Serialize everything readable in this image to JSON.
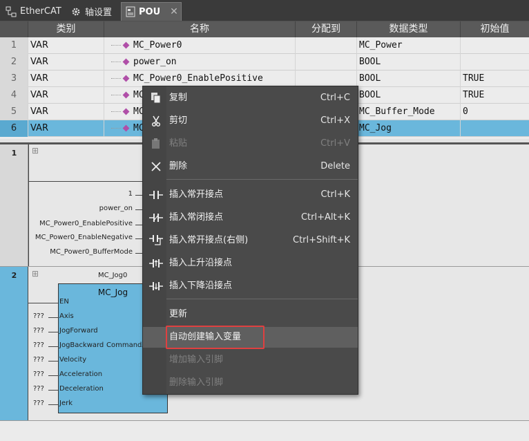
{
  "tabs": [
    {
      "label": "EtherCAT",
      "icon": "network-tree-icon"
    },
    {
      "label": "轴设置",
      "icon": "gear-icon"
    },
    {
      "label": "POU",
      "icon": "document-icon",
      "close": "✕"
    }
  ],
  "table": {
    "headers": [
      "类别",
      "名称",
      "分配到",
      "数据类型",
      "初始值"
    ],
    "rows": [
      {
        "n": "1",
        "cat": "VAR",
        "name": "MC_Power0",
        "assign": "",
        "type": "MC_Power",
        "init": ""
      },
      {
        "n": "2",
        "cat": "VAR",
        "name": "power_on",
        "assign": "",
        "type": "BOOL",
        "init": ""
      },
      {
        "n": "3",
        "cat": "VAR",
        "name": "MC_Power0_EnablePositive",
        "assign": "",
        "type": "BOOL",
        "init": "TRUE"
      },
      {
        "n": "4",
        "cat": "VAR",
        "name": "MC",
        "assign": "",
        "type": "BOOL",
        "init": "TRUE"
      },
      {
        "n": "5",
        "cat": "VAR",
        "name": "MC",
        "assign": "",
        "type": "MC_Buffer_Mode",
        "init": "0"
      },
      {
        "n": "6",
        "cat": "VAR",
        "name": "MC",
        "assign": "",
        "type": "MC_Jog",
        "init": ""
      }
    ]
  },
  "ladder": {
    "rung1": {
      "num": "1",
      "expand": "⊞",
      "inputs": [
        "1",
        "power_on",
        "MC_Power0_EnablePositive",
        "MC_Power0_EnableNegative",
        "MC_Power0_BufferMode"
      ]
    },
    "rung2": {
      "num": "2",
      "expand": "⊞",
      "instance": "MC_Jog0",
      "block_name": "MC_Jog",
      "pins": [
        "EN",
        "Axis",
        "JogForward",
        "JogBackward",
        "Velocity",
        "Acceleration",
        "Deceleration",
        "Jerk"
      ],
      "pin_extra": "CommandA",
      "unknown": "???"
    }
  },
  "context_menu": {
    "items": [
      {
        "label": "复制",
        "shortcut": "Ctrl+C",
        "icon": "copy-icon",
        "enabled": true
      },
      {
        "label": "剪切",
        "shortcut": "Ctrl+X",
        "icon": "scissors-icon",
        "enabled": true
      },
      {
        "label": "粘贴",
        "shortcut": "Ctrl+V",
        "icon": "paste-icon",
        "enabled": false
      },
      {
        "label": "删除",
        "shortcut": "Delete",
        "icon": "delete-x-icon",
        "enabled": true
      },
      {
        "label": "插入常开接点",
        "shortcut": "Ctrl+K",
        "icon": "no-contact-icon",
        "enabled": true
      },
      {
        "label": "插入常闭接点",
        "shortcut": "Ctrl+Alt+K",
        "icon": "nc-contact-icon",
        "enabled": true
      },
      {
        "label": "插入常开接点(右侧)",
        "shortcut": "Ctrl+Shift+K",
        "icon": "no-contact-right-icon",
        "enabled": true
      },
      {
        "label": "插入上升沿接点",
        "shortcut": "",
        "icon": "rising-edge-icon",
        "enabled": true
      },
      {
        "label": "插入下降沿接点",
        "shortcut": "",
        "icon": "falling-edge-icon",
        "enabled": true
      },
      {
        "label": "更新",
        "shortcut": "",
        "icon": "",
        "enabled": true
      },
      {
        "label": "自动创建输入变量",
        "shortcut": "",
        "icon": "",
        "enabled": true
      },
      {
        "label": "增加输入引脚",
        "shortcut": "",
        "icon": "",
        "enabled": false
      },
      {
        "label": "删除输入引脚",
        "shortcut": "",
        "icon": "",
        "enabled": false
      }
    ]
  },
  "colors": {
    "highlight_box": "#e04040",
    "selected_row": "#6ab7dc"
  }
}
